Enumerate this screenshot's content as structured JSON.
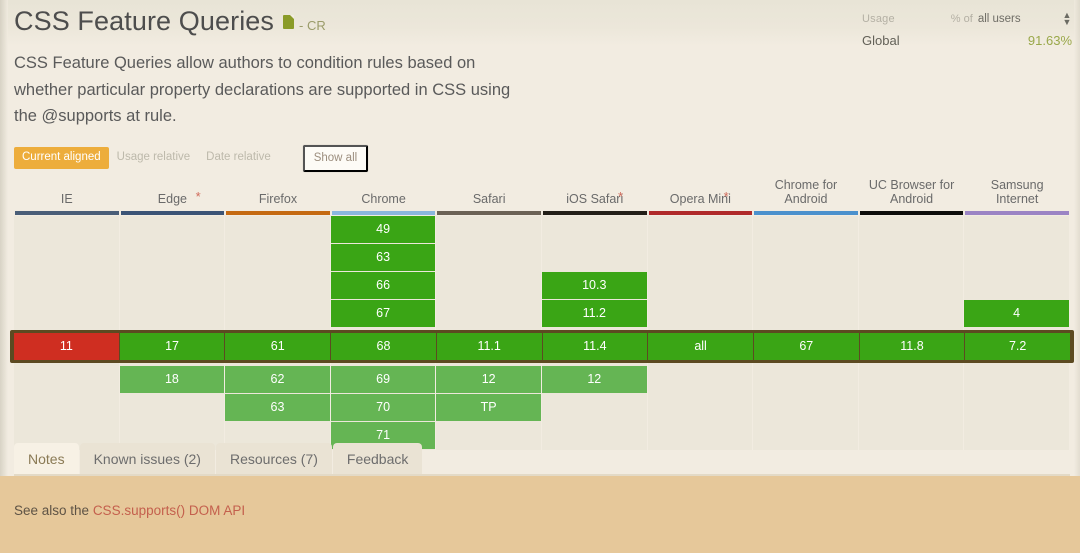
{
  "header": {
    "title": "CSS Feature Queries",
    "spec_icon": "document-icon",
    "spec_status": "- CR",
    "usage_label": "Usage",
    "usage_pct_of": "% of",
    "usage_scope": "all users",
    "select_arrows": "↕",
    "global_label": "Global",
    "global_value": "91.63%"
  },
  "description": "CSS Feature Queries allow authors to condition rules based on whether particular property declarations are supported in CSS using the @supports at rule.",
  "filters": {
    "items": [
      {
        "label": "Current aligned",
        "active": true
      },
      {
        "label": "Usage relative",
        "active": false
      },
      {
        "label": "Date relative",
        "active": false
      }
    ],
    "show_all": "Show all"
  },
  "table": {
    "columns": [
      {
        "name": "IE",
        "star": false,
        "rule_color": "#4a5e78"
      },
      {
        "name": "Edge",
        "star": true,
        "rule_color": "#3b5476"
      },
      {
        "name": "Firefox",
        "star": false,
        "rule_color": "#c56a11"
      },
      {
        "name": "Chrome",
        "star": false,
        "rule_color": "#8bb7de"
      },
      {
        "name": "Safari",
        "star": false,
        "rule_color": "#6b6255"
      },
      {
        "name": "iOS Safari",
        "star": true,
        "rule_color": "#231f18"
      },
      {
        "name": "Opera Mini",
        "star": true,
        "rule_color": "#b02a2a"
      },
      {
        "name": "Chrome for Android",
        "star": false,
        "rule_color": "#4b91cd"
      },
      {
        "name": "UC Browser for Android",
        "star": false,
        "rule_color": "#0d0d0a"
      },
      {
        "name": "Samsung Internet",
        "star": false,
        "rule_color": "#9b84c4"
      }
    ],
    "past_rows": [
      [
        "",
        "",
        "",
        "49",
        "",
        "",
        "",
        "",
        "",
        ""
      ],
      [
        "",
        "",
        "",
        "63",
        "",
        "",
        "",
        "",
        "",
        ""
      ],
      [
        "",
        "",
        "",
        "66",
        "",
        "10.3",
        "",
        "",
        "",
        ""
      ],
      [
        "",
        "",
        "",
        "67",
        "",
        "11.2",
        "",
        "",
        "",
        "4"
      ]
    ],
    "current_row": [
      {
        "v": "11",
        "supported": false
      },
      {
        "v": "17",
        "supported": true
      },
      {
        "v": "61",
        "supported": true
      },
      {
        "v": "68",
        "supported": true
      },
      {
        "v": "11.1",
        "supported": true
      },
      {
        "v": "11.4",
        "supported": true
      },
      {
        "v": "all",
        "supported": true
      },
      {
        "v": "67",
        "supported": true
      },
      {
        "v": "11.8",
        "supported": true
      },
      {
        "v": "7.2",
        "supported": true
      }
    ],
    "future_rows": [
      [
        "",
        "18",
        "62",
        "69",
        "12",
        "12",
        "",
        "",
        "",
        ""
      ],
      [
        "",
        "",
        "63",
        "70",
        "TP",
        "",
        "",
        "",
        "",
        ""
      ],
      [
        "",
        "",
        "",
        "71",
        "",
        "",
        "",
        "",
        "",
        ""
      ]
    ]
  },
  "tabs": [
    {
      "label": "Notes",
      "active": true
    },
    {
      "label": "Known issues (2)",
      "active": false
    },
    {
      "label": "Resources (7)",
      "active": false
    },
    {
      "label": "Feedback",
      "active": false
    }
  ],
  "note": {
    "prefix": "See also the ",
    "link": "CSS.supports() DOM API"
  },
  "colors": {
    "accent": "#edad3c",
    "supported": "#3aa515",
    "supported_future": "#65b554",
    "unsupported": "#cf2e21",
    "page_bg": "#f2ece1",
    "note_bg": "#e6c89a"
  }
}
